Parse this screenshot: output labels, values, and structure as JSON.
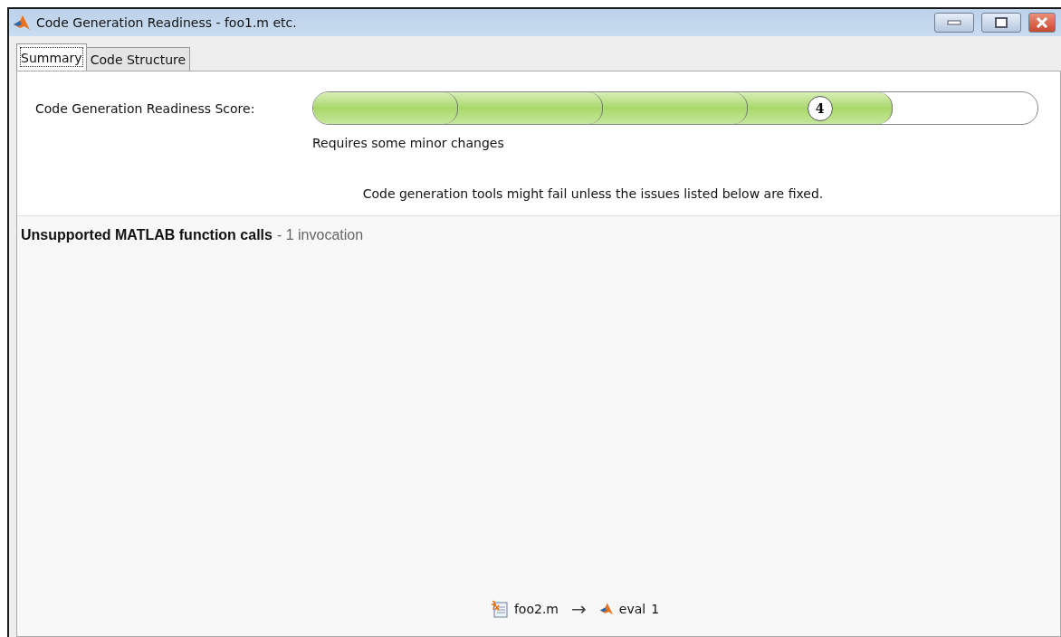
{
  "window": {
    "title": "Code Generation Readiness - foo1.m etc."
  },
  "tabs": [
    {
      "label": "Summary",
      "selected": true
    },
    {
      "label": "Code Structure",
      "selected": false
    }
  ],
  "score": {
    "label": "Code Generation Readiness Score:",
    "value": "4",
    "level": 0.8,
    "verdict": "Requires some minor changes"
  },
  "message": "Code generation tools might fail unless the issues listed below are fixed.",
  "issue": {
    "title": "Unsupported MATLAB function calls",
    "count": "- 1 invocation",
    "calls": [
      {
        "file": "foo2.m",
        "arrow": "→",
        "function": "eval",
        "count": "1"
      }
    ]
  }
}
